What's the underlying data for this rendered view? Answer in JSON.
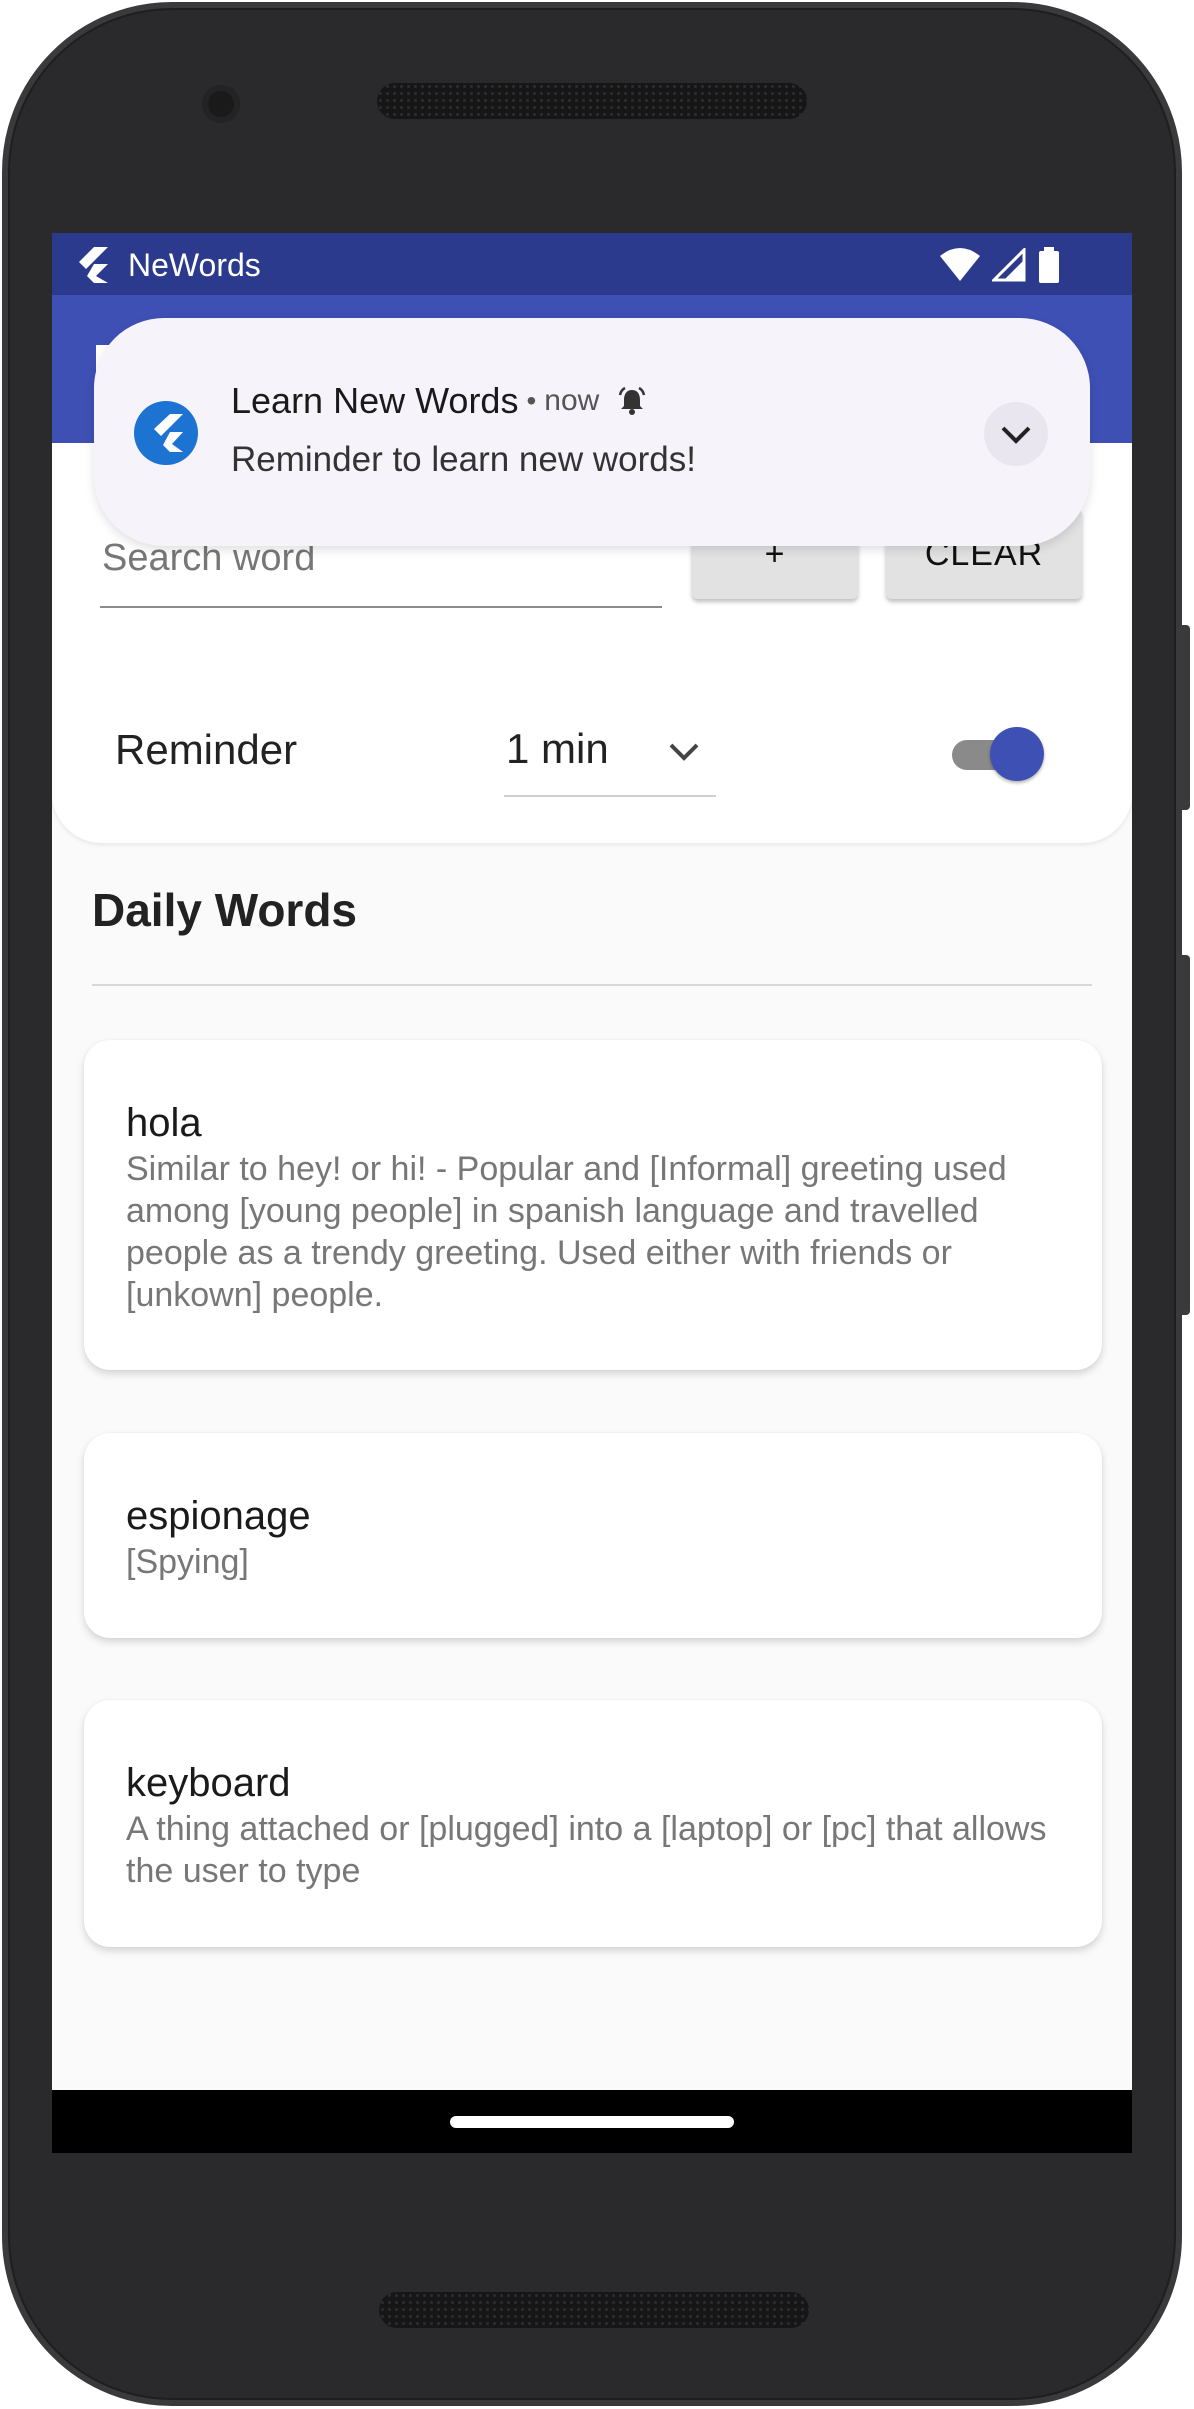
{
  "status_bar": {
    "app_name": "NeWords",
    "icons": [
      "wifi-icon",
      "signal-icon",
      "battery-icon"
    ]
  },
  "notification": {
    "app_name": "Learn New Words",
    "separator": "•",
    "time": "now",
    "message": "Reminder to learn new words!",
    "icon": "flutter-logo-icon"
  },
  "search": {
    "placeholder": "Search word",
    "add_label": "+",
    "clear_label": "CLEAR"
  },
  "reminder": {
    "label": "Reminder",
    "interval": "1 min",
    "enabled": true
  },
  "section": {
    "title": "Daily Words"
  },
  "words": [
    {
      "word": "hola",
      "description": "Similar to hey! or hi! - Popular and [Informal] greeting used among [young people] in spanish language and travelled people as a trendy greeting.  Used either with friends or [unkown] people."
    },
    {
      "word": "espionage",
      "description": "[Spying]"
    },
    {
      "word": "keyboard",
      "description": "A thing attached or [plugged] into a [laptop] or [pc] that allows the user to type"
    }
  ],
  "colors": {
    "primary": "#3e50b4",
    "status_bar": "#2b3a8c",
    "background": "#fafafa"
  }
}
